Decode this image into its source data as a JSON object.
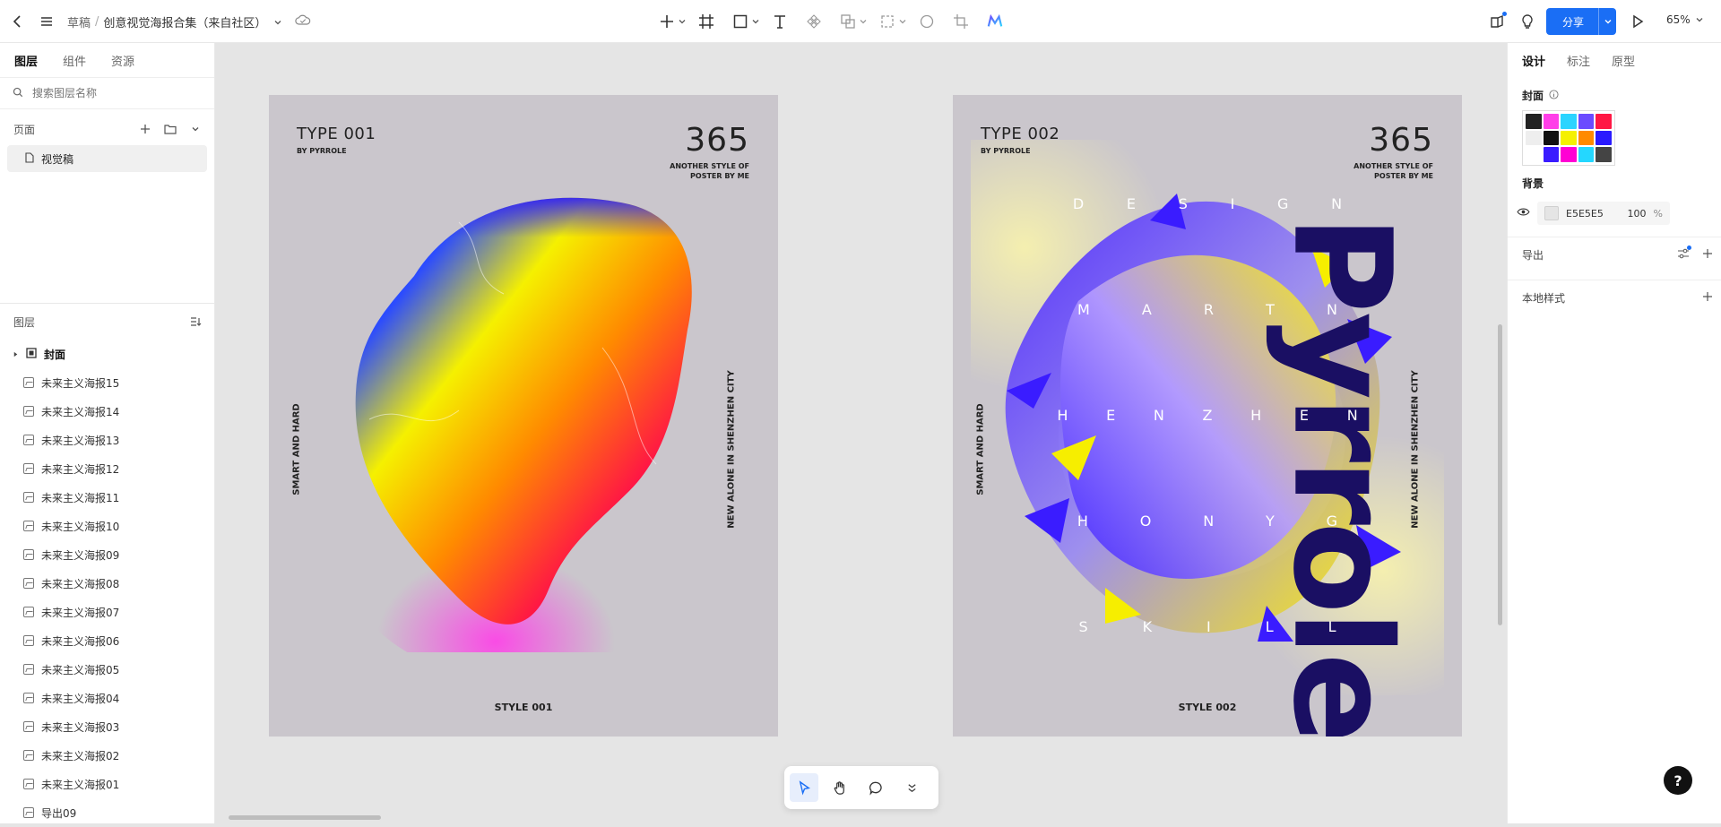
{
  "header": {
    "breadcrumb_root": "草稿",
    "breadcrumb_sep": "/",
    "doc_title": "创意视觉海报合集（来自社区）",
    "share_label": "分享",
    "zoom": "65%"
  },
  "left_panel": {
    "tabs": [
      "图层",
      "组件",
      "资源"
    ],
    "search_placeholder": "搜索图层名称",
    "pages_title": "页面",
    "pages": [
      "视觉稿"
    ],
    "layers_title": "图层",
    "layers": [
      {
        "name": "封面",
        "type": "group"
      },
      {
        "name": "未来主义海报15"
      },
      {
        "name": "未来主义海报14"
      },
      {
        "name": "未来主义海报13"
      },
      {
        "name": "未来主义海报12"
      },
      {
        "name": "未来主义海报11"
      },
      {
        "name": "未来主义海报10"
      },
      {
        "name": "未来主义海报09"
      },
      {
        "name": "未来主义海报08"
      },
      {
        "name": "未来主义海报07"
      },
      {
        "name": "未来主义海报06"
      },
      {
        "name": "未来主义海报05"
      },
      {
        "name": "未来主义海报04"
      },
      {
        "name": "未来主义海报03"
      },
      {
        "name": "未来主义海报02"
      },
      {
        "name": "未来主义海报01"
      },
      {
        "name": "导出09"
      }
    ]
  },
  "posters": [
    {
      "type": "TYPE 001",
      "by": "BY PYRROLE",
      "number": "365",
      "sub_line1": "ANOTHER STYLE OF",
      "sub_line2": "POSTER BY ME",
      "side_left": "SMART AND HARD",
      "side_right": "NEW ALONE IN SHENZHEN CITY",
      "style": "STYLE 001"
    },
    {
      "type": "TYPE 002",
      "by": "BY PYRROLE",
      "number": "365",
      "sub_line1": "ANOTHER STYLE OF",
      "sub_line2": "POSTER BY ME",
      "side_left": "SMART AND HARD",
      "side_right": "NEW ALONE IN SHENZHEN CITY",
      "style": "STYLE 002",
      "big_word": "Pyrrole",
      "letter_rows": [
        [
          "D",
          "E",
          "S",
          "I",
          "G",
          "N"
        ],
        [
          "M",
          "A",
          "R",
          "T",
          "N"
        ],
        [
          "H",
          "E",
          "N",
          "Z",
          "H",
          "E",
          "N"
        ],
        [
          "H",
          "O",
          "N",
          "Y",
          "G"
        ],
        [
          "S",
          "K",
          "I",
          "L",
          "L"
        ]
      ]
    }
  ],
  "right_panel": {
    "tabs": [
      "设计",
      "标注",
      "原型"
    ],
    "cover_label": "封面",
    "background_label": "背景",
    "bg_color_hex": "E5E5E5",
    "bg_opacity": "100",
    "bg_opacity_unit": "%",
    "export_label": "导出",
    "local_styles_label": "本地样式"
  },
  "colors": {
    "accent": "#1a6ef5",
    "canvas_bg": "#e5e5e5",
    "poster_bg": "#cac6cc",
    "big_word": "#1a0f63"
  },
  "help_label": "?"
}
